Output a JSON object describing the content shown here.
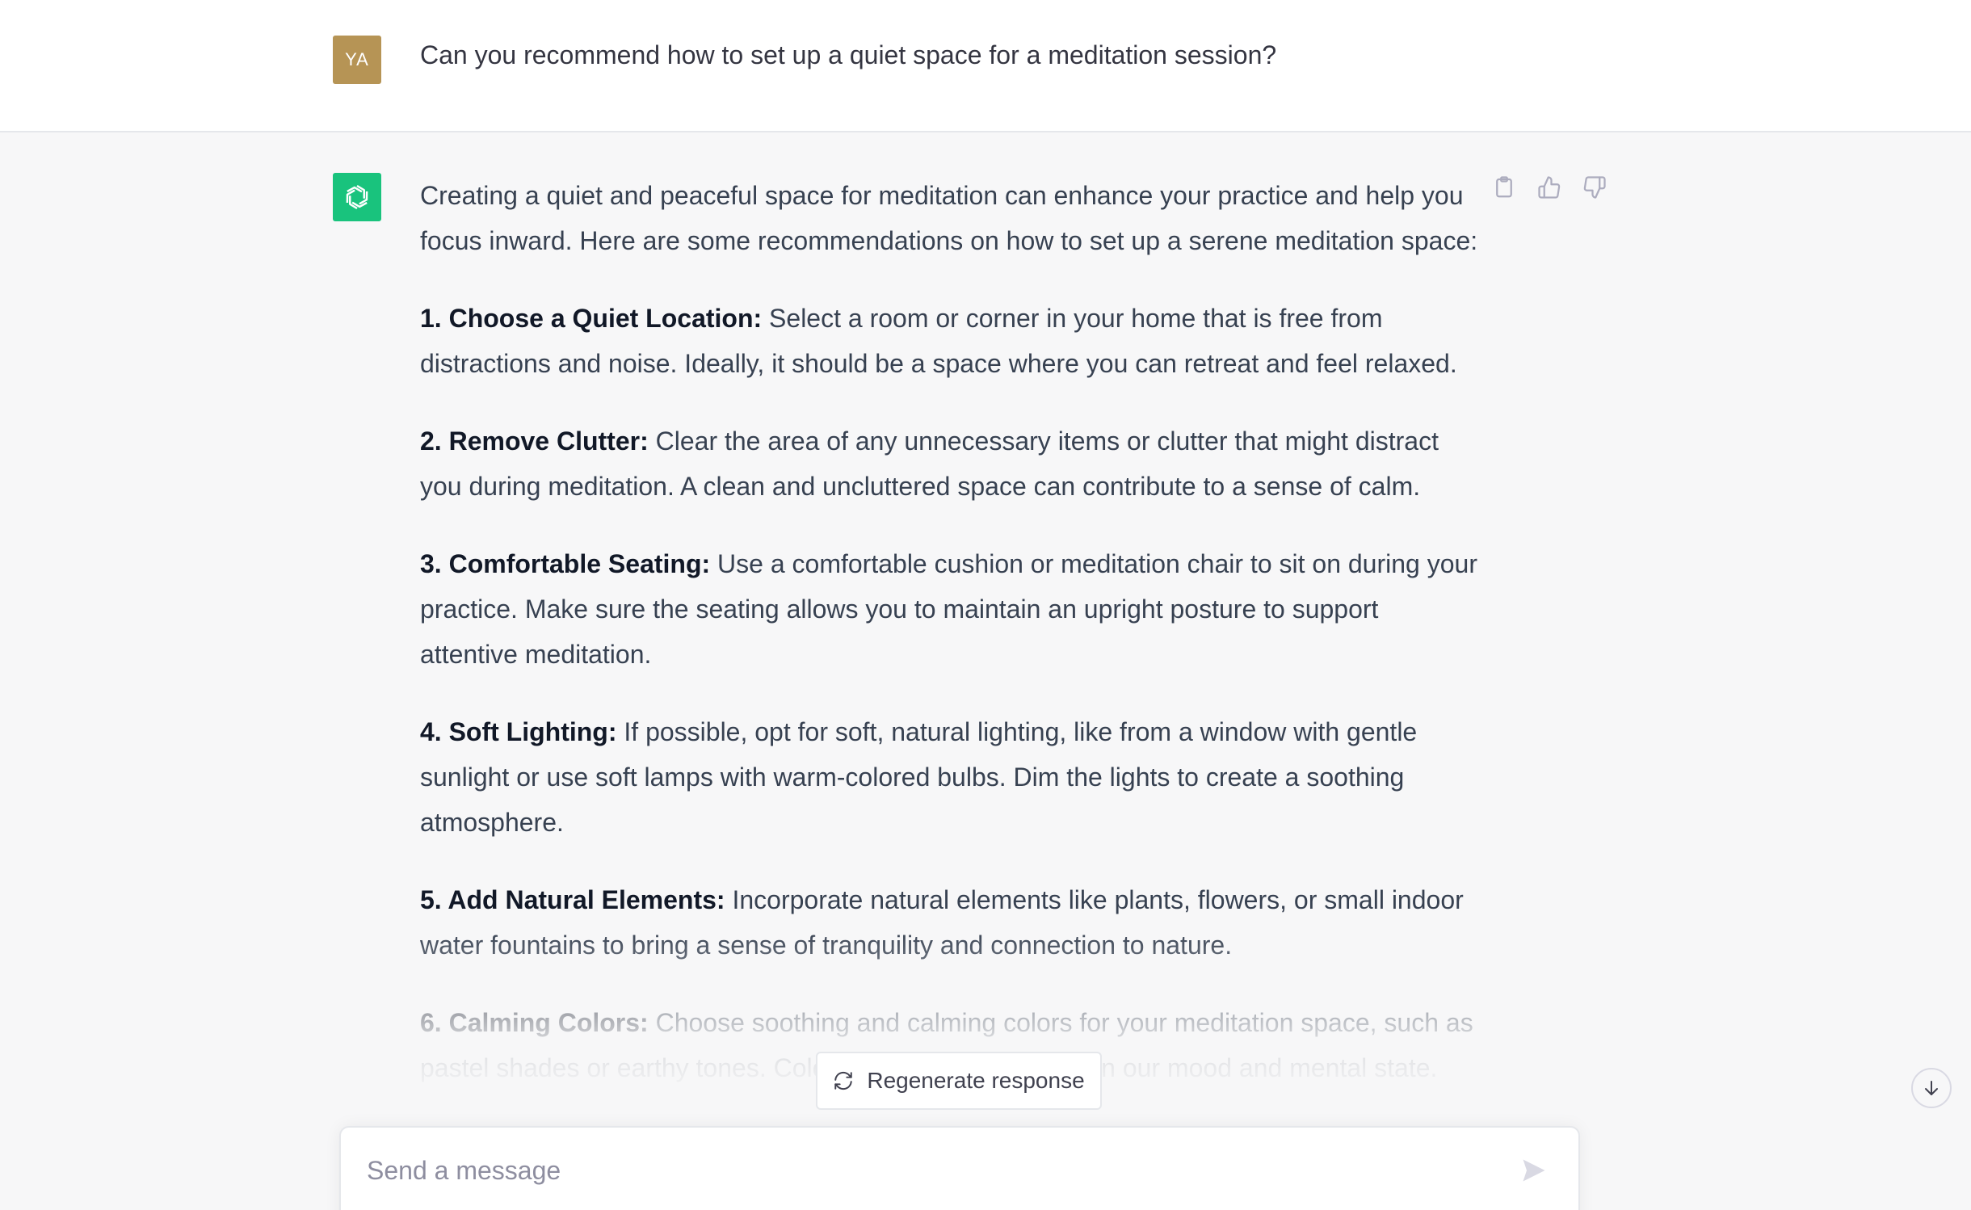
{
  "user_message": {
    "avatar_initials": "YA",
    "text": "Can you recommend how to set up a quiet space for a meditation session?"
  },
  "assistant_message": {
    "intro": "Creating a quiet and peaceful space for meditation can enhance your practice and help you focus inward. Here are some recommendations on how to set up a serene meditation space:",
    "items": [
      {
        "title": "1. Choose a Quiet Location:",
        "text": " Select a room or corner in your home that is free from distractions and noise. Ideally, it should be a space where you can retreat and feel relaxed."
      },
      {
        "title": "2. Remove Clutter:",
        "text": " Clear the area of any unnecessary items or clutter that might distract you during meditation. A clean and uncluttered space can contribute to a sense of calm."
      },
      {
        "title": "3. Comfortable Seating:",
        "text": " Use a comfortable cushion or meditation chair to sit on during your practice. Make sure the seating allows you to maintain an upright posture to support attentive meditation."
      },
      {
        "title": "4. Soft Lighting:",
        "text": " If possible, opt for soft, natural lighting, like from a window with gentle sunlight or use soft lamps with warm-colored bulbs. Dim the lights to create a soothing atmosphere."
      },
      {
        "title": "5. Add Natural Elements:",
        "text": " Incorporate natural elements like plants, flowers, or small indoor water fountains to bring a sense of tranquility and connection to nature."
      },
      {
        "title": "6. Calming Colors:",
        "text": " Choose soothing and calming colors for your meditation space, such as pastel shades or earthy tones. Colors can have an impact on our mood and mental state."
      }
    ]
  },
  "actions": {
    "copy_icon": "clipboard-icon",
    "like_icon": "thumbs-up-icon",
    "dislike_icon": "thumbs-down-icon"
  },
  "regenerate": {
    "label": "Regenerate response",
    "icon": "refresh-icon"
  },
  "composer": {
    "placeholder": "Send a message",
    "value": "",
    "send_icon": "send-icon"
  },
  "scroll_down_icon": "arrow-down-icon",
  "colors": {
    "user_avatar": "#b69455",
    "assistant_avatar": "#19c37d",
    "assistant_background": "#f7f7f8"
  }
}
